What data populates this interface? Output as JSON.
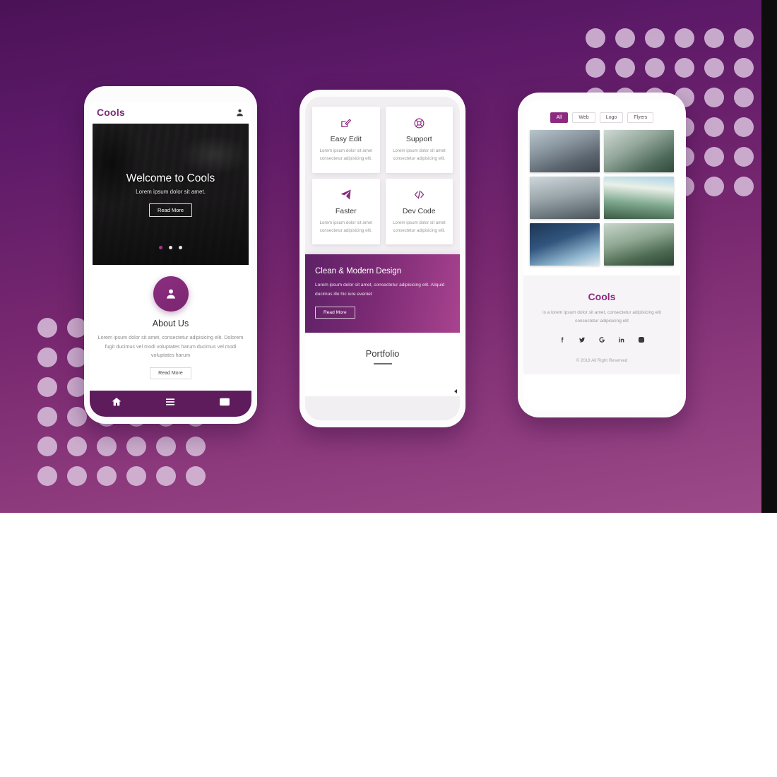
{
  "theme": {
    "bg_gradient_start": "#4b1257",
    "bg_gradient_end": "#9c4a88",
    "accent": "#8c2a80",
    "dot_color": "#d9c2dd",
    "nav_bar": "#5f1c5d"
  },
  "phone1": {
    "brand": "Cools",
    "user_icon": "user-icon",
    "hero": {
      "title": "Welcome to Cools",
      "subtitle": "Lorem ipsum dolor sit amet.",
      "button": "Read More",
      "slides": 3,
      "active_slide": 1
    },
    "about": {
      "avatar_icon": "user-avatar-icon",
      "title": "About Us",
      "text": "Lorem ipsum dolor sit amet, consectetur adipisicing elit. Dolorem fugit ducimus vel modi voluptates harum ducimus vel modi voluptates harum",
      "button": "Read More"
    },
    "nav": [
      {
        "icon": "home-icon",
        "label": "Home"
      },
      {
        "icon": "menu-icon",
        "label": "Menu"
      },
      {
        "icon": "mail-icon",
        "label": "Mail"
      }
    ]
  },
  "phone2": {
    "cards": [
      {
        "icon": "edit-pencil-icon",
        "title": "Easy Edit",
        "text": "Lorem ipsum dolor sit amet consectetur adipisicing elit."
      },
      {
        "icon": "lifebuoy-support-icon",
        "title": "Support",
        "text": "Lorem ipsum dolor sit amet consectetur adipisicing elit."
      },
      {
        "icon": "paper-plane-icon",
        "title": "Faster",
        "text": "Lorem ipsum dolor sit amet consectetur adipisicing elit."
      },
      {
        "icon": "code-brackets-icon",
        "title": "Dev Code",
        "text": "Lorem ipsum dolor sit amet consectetur adipisicing elit."
      }
    ],
    "banner": {
      "title": "Clean & Modern Design",
      "text": "Lorem ipsum dolor sit amet, consectetur adipisicing elit. Aliquid ducimus illo hic iure eveniet",
      "button": "Read More"
    },
    "portfolio": {
      "title": "Portfolio"
    }
  },
  "phone3": {
    "filters": [
      {
        "label": "All",
        "active": true
      },
      {
        "label": "Web",
        "active": false
      },
      {
        "label": "Logo",
        "active": false
      },
      {
        "label": "Flyers",
        "active": false
      }
    ],
    "gallery": [
      {
        "alt": "foggy-forest-branches-photo"
      },
      {
        "alt": "mountain-lake-trees-photo"
      },
      {
        "alt": "mountain-road-photo"
      },
      {
        "alt": "hiker-on-cliff-sunrise-photo"
      },
      {
        "alt": "snowy-mountain-peak-photo"
      },
      {
        "alt": "misty-forest-river-photo"
      }
    ],
    "footer": {
      "brand": "Cools",
      "text": "is a lorem ipsum dolor sit amet, consectetur adipisicing elit consectetur adipisicing elit",
      "socials": [
        {
          "icon": "facebook-icon",
          "label": "Facebook"
        },
        {
          "icon": "twitter-icon",
          "label": "Twitter"
        },
        {
          "icon": "google-icon",
          "label": "Google"
        },
        {
          "icon": "linkedin-icon",
          "label": "LinkedIn"
        },
        {
          "icon": "instagram-icon",
          "label": "Instagram"
        }
      ],
      "copyright": "© 2018 All Right Reserved"
    }
  }
}
